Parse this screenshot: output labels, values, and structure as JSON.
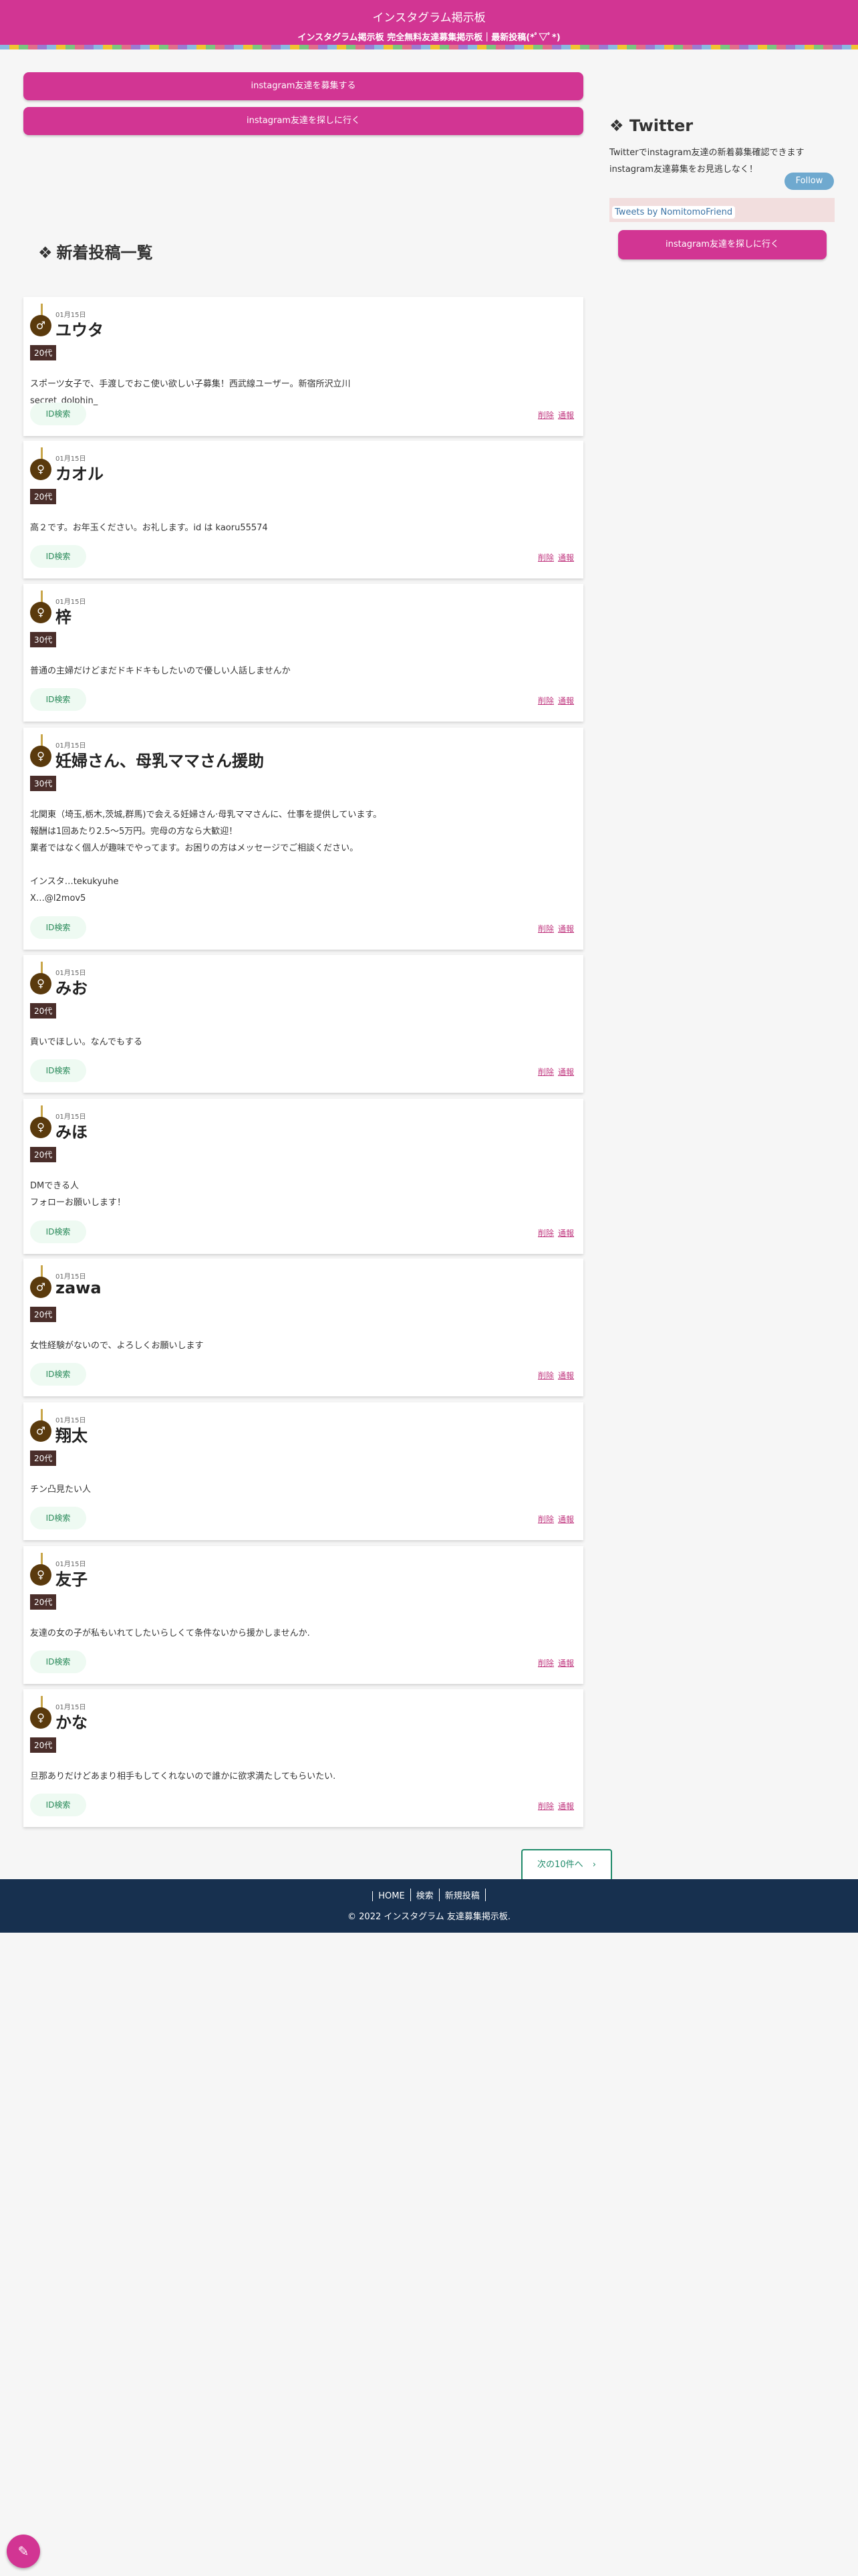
{
  "header": {
    "title": "インスタグラム掲示板",
    "subtitle": "インスタグラム掲示板 完全無料友達募集掲示板｜最新投稿(*ﾟ▽ﾟ*)"
  },
  "main": {
    "btn_recruit": "instagram友達を募集する",
    "btn_find": "instagram友達を探しに行く",
    "section_title": "新着投稿一覧",
    "next_label": "次の10件へ",
    "id_search_label": "ID検索",
    "delete_label": "削除",
    "report_label": "通報",
    "posts": [
      {
        "date": "01月15日",
        "gender": "♂",
        "name": "ユウタ",
        "age": "20代",
        "message": "スポーツ女子で、手渡しでおこ使い欲しい子募集！西武線ユーザー。新宿所沢立川\nsecret_dolphin_"
      },
      {
        "date": "01月15日",
        "gender": "♀",
        "name": "カオル",
        "age": "20代",
        "message": "高２です。お年玉ください。お礼します。id は kaoru55574"
      },
      {
        "date": "01月15日",
        "gender": "♀",
        "name": "梓",
        "age": "30代",
        "message": "普通の主婦だけどまだドキドキもしたいので優しい人話しませんか"
      },
      {
        "date": "01月15日",
        "gender": "♀",
        "name": "妊婦さん、母乳ママさん援助",
        "age": "30代",
        "message": "北関東（埼玉,栃木,茨城,群馬)で会える妊婦さん·母乳ママさんに、仕事を提供しています。\n報酬は1回あたり2.5〜5万円。完母の方なら大歓迎！\n業者ではなく個人が趣味でやってます。お困りの方はメッセージでご相談ください。\n\nインスタ…tekukyuhe\nX…@l2mov5"
      },
      {
        "date": "01月15日",
        "gender": "♀",
        "name": "みお",
        "age": "20代",
        "message": "貢いでほしい。なんでもする"
      },
      {
        "date": "01月15日",
        "gender": "♀",
        "name": "みほ",
        "age": "20代",
        "message": "DMできる人\nフォローお願いします！"
      },
      {
        "date": "01月15日",
        "gender": "♂",
        "name": "zawa",
        "age": "20代",
        "message": "女性経験がないので、よろしくお願いします"
      },
      {
        "date": "01月15日",
        "gender": "♂",
        "name": "翔太",
        "age": "20代",
        "message": "チン凸見たい人"
      },
      {
        "date": "01月15日",
        "gender": "♀",
        "name": "友子",
        "age": "20代",
        "message": "友達の女の子が私もいれてしたいらしくて条件ないから援かしませんか."
      },
      {
        "date": "01月15日",
        "gender": "♀",
        "name": "かな",
        "age": "20代",
        "message": "旦那ありだけどあまり相手もしてくれないので誰かに欲求満たしてもらいたい."
      }
    ]
  },
  "side": {
    "title": "Twitter",
    "desc_1": "Twitterでinstagram友達の新着募集確認できます",
    "desc_2": "instagram友達募集をお見逃しなく！",
    "follow_label": "Follow",
    "tweets_label": "Tweets by NomitomoFriend",
    "btn_find": "instagram友達を探しに行く"
  },
  "footer": {
    "links": [
      "HOME",
      "検索",
      "新規投稿"
    ],
    "copyright": "© 2022 インスタグラム 友達募集掲示板."
  },
  "icons": {
    "diamond": "❖",
    "pencil": "✎",
    "chevron": "›"
  }
}
